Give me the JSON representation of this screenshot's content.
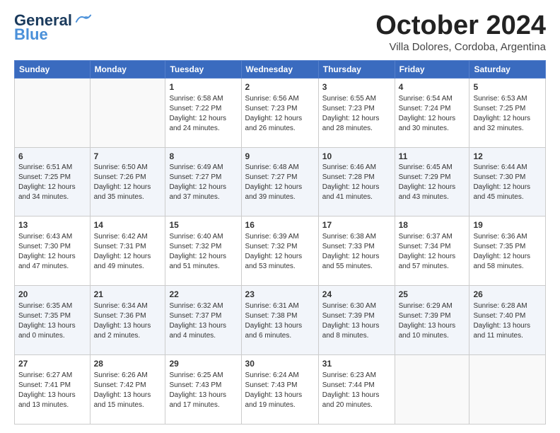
{
  "header": {
    "logo_line1": "General",
    "logo_line2": "Blue",
    "month": "October 2024",
    "location": "Villa Dolores, Cordoba, Argentina"
  },
  "weekdays": [
    "Sunday",
    "Monday",
    "Tuesday",
    "Wednesday",
    "Thursday",
    "Friday",
    "Saturday"
  ],
  "weeks": [
    [
      {
        "day": "",
        "info": ""
      },
      {
        "day": "",
        "info": ""
      },
      {
        "day": "1",
        "info": "Sunrise: 6:58 AM\nSunset: 7:22 PM\nDaylight: 12 hours\nand 24 minutes."
      },
      {
        "day": "2",
        "info": "Sunrise: 6:56 AM\nSunset: 7:23 PM\nDaylight: 12 hours\nand 26 minutes."
      },
      {
        "day": "3",
        "info": "Sunrise: 6:55 AM\nSunset: 7:23 PM\nDaylight: 12 hours\nand 28 minutes."
      },
      {
        "day": "4",
        "info": "Sunrise: 6:54 AM\nSunset: 7:24 PM\nDaylight: 12 hours\nand 30 minutes."
      },
      {
        "day": "5",
        "info": "Sunrise: 6:53 AM\nSunset: 7:25 PM\nDaylight: 12 hours\nand 32 minutes."
      }
    ],
    [
      {
        "day": "6",
        "info": "Sunrise: 6:51 AM\nSunset: 7:25 PM\nDaylight: 12 hours\nand 34 minutes."
      },
      {
        "day": "7",
        "info": "Sunrise: 6:50 AM\nSunset: 7:26 PM\nDaylight: 12 hours\nand 35 minutes."
      },
      {
        "day": "8",
        "info": "Sunrise: 6:49 AM\nSunset: 7:27 PM\nDaylight: 12 hours\nand 37 minutes."
      },
      {
        "day": "9",
        "info": "Sunrise: 6:48 AM\nSunset: 7:27 PM\nDaylight: 12 hours\nand 39 minutes."
      },
      {
        "day": "10",
        "info": "Sunrise: 6:46 AM\nSunset: 7:28 PM\nDaylight: 12 hours\nand 41 minutes."
      },
      {
        "day": "11",
        "info": "Sunrise: 6:45 AM\nSunset: 7:29 PM\nDaylight: 12 hours\nand 43 minutes."
      },
      {
        "day": "12",
        "info": "Sunrise: 6:44 AM\nSunset: 7:30 PM\nDaylight: 12 hours\nand 45 minutes."
      }
    ],
    [
      {
        "day": "13",
        "info": "Sunrise: 6:43 AM\nSunset: 7:30 PM\nDaylight: 12 hours\nand 47 minutes."
      },
      {
        "day": "14",
        "info": "Sunrise: 6:42 AM\nSunset: 7:31 PM\nDaylight: 12 hours\nand 49 minutes."
      },
      {
        "day": "15",
        "info": "Sunrise: 6:40 AM\nSunset: 7:32 PM\nDaylight: 12 hours\nand 51 minutes."
      },
      {
        "day": "16",
        "info": "Sunrise: 6:39 AM\nSunset: 7:32 PM\nDaylight: 12 hours\nand 53 minutes."
      },
      {
        "day": "17",
        "info": "Sunrise: 6:38 AM\nSunset: 7:33 PM\nDaylight: 12 hours\nand 55 minutes."
      },
      {
        "day": "18",
        "info": "Sunrise: 6:37 AM\nSunset: 7:34 PM\nDaylight: 12 hours\nand 57 minutes."
      },
      {
        "day": "19",
        "info": "Sunrise: 6:36 AM\nSunset: 7:35 PM\nDaylight: 12 hours\nand 58 minutes."
      }
    ],
    [
      {
        "day": "20",
        "info": "Sunrise: 6:35 AM\nSunset: 7:35 PM\nDaylight: 13 hours\nand 0 minutes."
      },
      {
        "day": "21",
        "info": "Sunrise: 6:34 AM\nSunset: 7:36 PM\nDaylight: 13 hours\nand 2 minutes."
      },
      {
        "day": "22",
        "info": "Sunrise: 6:32 AM\nSunset: 7:37 PM\nDaylight: 13 hours\nand 4 minutes."
      },
      {
        "day": "23",
        "info": "Sunrise: 6:31 AM\nSunset: 7:38 PM\nDaylight: 13 hours\nand 6 minutes."
      },
      {
        "day": "24",
        "info": "Sunrise: 6:30 AM\nSunset: 7:39 PM\nDaylight: 13 hours\nand 8 minutes."
      },
      {
        "day": "25",
        "info": "Sunrise: 6:29 AM\nSunset: 7:39 PM\nDaylight: 13 hours\nand 10 minutes."
      },
      {
        "day": "26",
        "info": "Sunrise: 6:28 AM\nSunset: 7:40 PM\nDaylight: 13 hours\nand 11 minutes."
      }
    ],
    [
      {
        "day": "27",
        "info": "Sunrise: 6:27 AM\nSunset: 7:41 PM\nDaylight: 13 hours\nand 13 minutes."
      },
      {
        "day": "28",
        "info": "Sunrise: 6:26 AM\nSunset: 7:42 PM\nDaylight: 13 hours\nand 15 minutes."
      },
      {
        "day": "29",
        "info": "Sunrise: 6:25 AM\nSunset: 7:43 PM\nDaylight: 13 hours\nand 17 minutes."
      },
      {
        "day": "30",
        "info": "Sunrise: 6:24 AM\nSunset: 7:43 PM\nDaylight: 13 hours\nand 19 minutes."
      },
      {
        "day": "31",
        "info": "Sunrise: 6:23 AM\nSunset: 7:44 PM\nDaylight: 13 hours\nand 20 minutes."
      },
      {
        "day": "",
        "info": ""
      },
      {
        "day": "",
        "info": ""
      }
    ]
  ]
}
